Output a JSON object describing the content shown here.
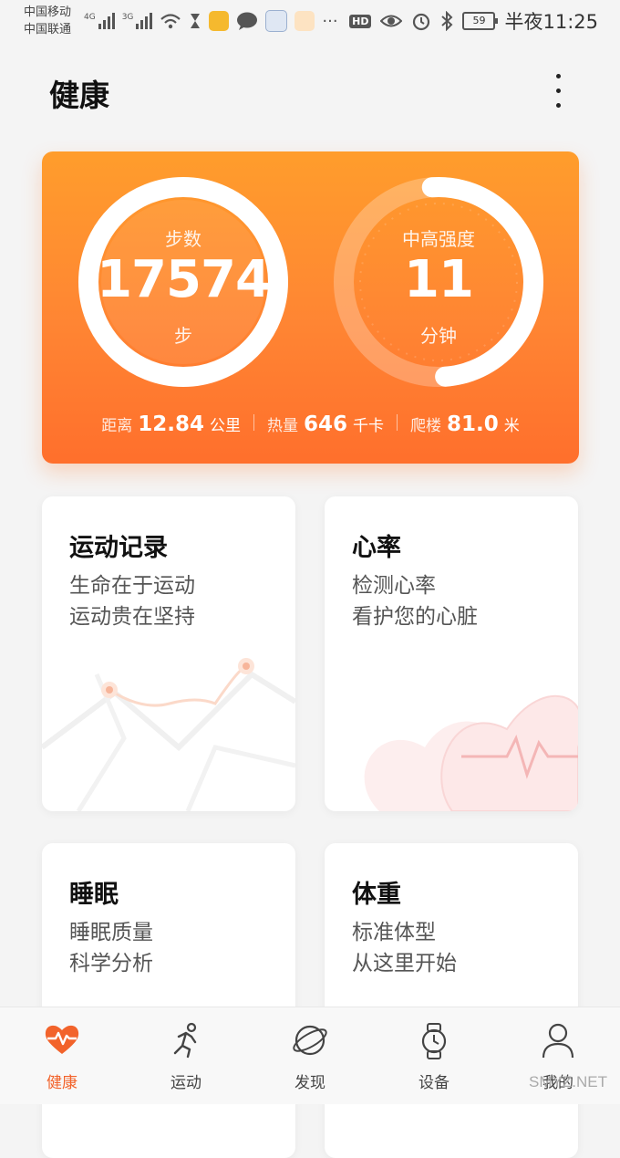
{
  "status_bar": {
    "carrier_1": "中国移动",
    "carrier_2": "中国联通",
    "network_1": "4G",
    "network_2": "3G",
    "more": "···",
    "hd": "HD",
    "battery": "59",
    "time": "半夜11:25"
  },
  "header": {
    "title": "健康"
  },
  "summary": {
    "steps": {
      "label": "步数",
      "value": "17574",
      "unit": "步"
    },
    "intensity": {
      "label": "中高强度",
      "value": "11",
      "unit": "分钟",
      "progress": 0.5
    },
    "stats": [
      {
        "label": "距离",
        "value": "12.84",
        "unit": "公里"
      },
      {
        "label": "热量",
        "value": "646",
        "unit": "千卡"
      },
      {
        "label": "爬楼",
        "value": "81.0",
        "unit": "米"
      }
    ]
  },
  "cards": [
    {
      "title": "运动记录",
      "sub1": "生命在于运动",
      "sub2": "运动贵在坚持"
    },
    {
      "title": "心率",
      "sub1": "检测心率",
      "sub2": "看护您的心脏"
    },
    {
      "title": "睡眠",
      "sub1": "睡眠质量",
      "sub2": "科学分析"
    },
    {
      "title": "体重",
      "sub1": "标准体型",
      "sub2": "从这里开始"
    }
  ],
  "nav": [
    {
      "label": "健康",
      "icon": "heart-pulse-icon",
      "active": true
    },
    {
      "label": "运动",
      "icon": "runner-icon"
    },
    {
      "label": "发现",
      "icon": "planet-icon"
    },
    {
      "label": "设备",
      "icon": "watch-icon"
    },
    {
      "label": "我的",
      "icon": "person-icon"
    }
  ],
  "watermark": "SMYZ.NET",
  "colors": {
    "accent": "#ff7f2e",
    "nav_active": "#f2632b"
  }
}
